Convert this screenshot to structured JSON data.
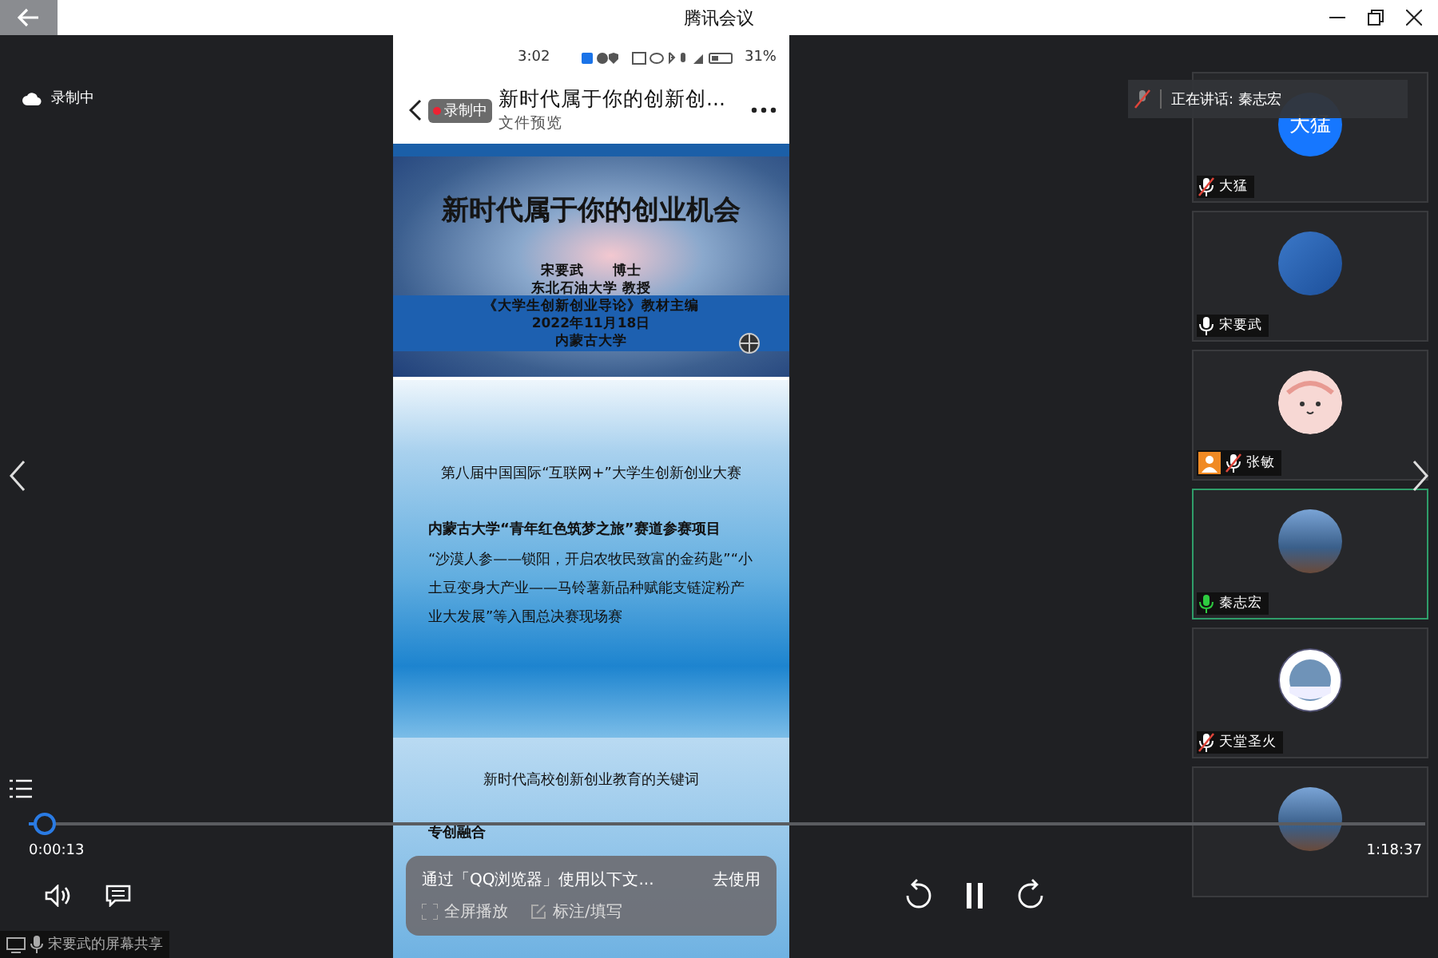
{
  "window": {
    "title": "腾讯会议"
  },
  "recording": {
    "label": "录制中"
  },
  "speaking": {
    "label": "正在讲话: 秦志宏"
  },
  "shared_screen": {
    "status_bar": {
      "time": "3:02",
      "battery": "31%"
    },
    "header": {
      "title": "新时代属于你的创新创...",
      "subtitle": "文件预览",
      "recording_badge": "录制中"
    },
    "slides": [
      {
        "kind": "cover",
        "title": "新时代属于你的创业机会",
        "lines": [
          "宋要武　　博士",
          "东北石油大学 教授",
          "《大学生创新创业导论》教材主编",
          "2022年11月18日",
          "内蒙古大学"
        ]
      },
      {
        "kind": "text",
        "heading": "第八届中国国际“互联网+”大学生创新创业大赛",
        "subheading": "内蒙古大学“青年红色筑梦之旅”赛道参赛项目",
        "body": "“沙漠人参——锁阳，开启农牧民致富的金药匙”“小土豆变身大产业——马铃薯新品种赋能支链淀粉产业大发展”等入围总决赛现场赛"
      },
      {
        "kind": "keywords",
        "heading": "新时代高校创新创业教育的关键词",
        "items": [
          "专创融合"
        ]
      }
    ],
    "popup": {
      "text": "通过「QQ浏览器」使用以下文...",
      "action": "去使用",
      "options": [
        "全屏播放",
        "标注/填写"
      ]
    }
  },
  "participants": [
    {
      "name": "大猛",
      "muted": true,
      "host": false,
      "speaking": false,
      "kind": "text",
      "avatar_text": "大猛"
    },
    {
      "name": "宋要武",
      "muted": false,
      "host": false,
      "speaking": false,
      "kind": "image"
    },
    {
      "name": "张敏",
      "muted": true,
      "host": true,
      "speaking": false,
      "kind": "cartoon"
    },
    {
      "name": "秦志宏",
      "muted": false,
      "host": false,
      "speaking": true,
      "kind": "photo"
    },
    {
      "name": "天堂圣火",
      "muted": true,
      "host": false,
      "speaking": false,
      "kind": "logo"
    },
    {
      "speaking": false,
      "kind": "photo"
    }
  ],
  "player": {
    "elapsed": "0:00:13",
    "duration": "1:18:37",
    "level": 0.003
  },
  "share_label": "宋要武的屏幕共享"
}
